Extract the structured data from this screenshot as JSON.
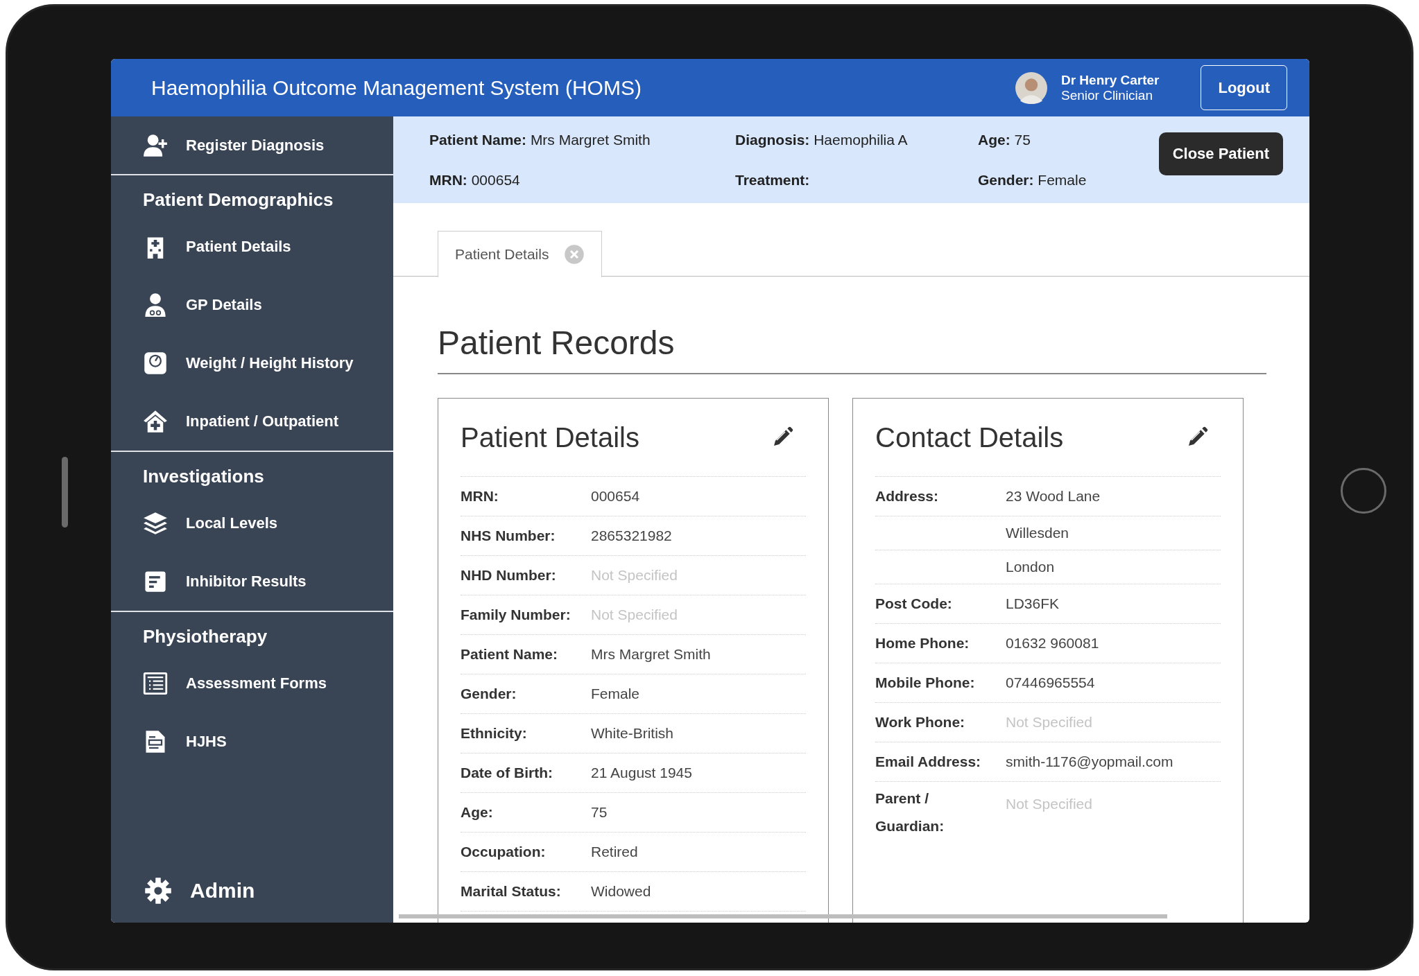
{
  "header": {
    "title": "Haemophilia Outcome Management System (HOMS)",
    "user_name": "Dr Henry Carter",
    "user_role": "Senior Clinician",
    "logout": "Logout"
  },
  "sidebar": {
    "items": [
      {
        "kind": "item",
        "label": "Register Diagnosis"
      },
      {
        "kind": "section",
        "label": "Patient Demographics"
      },
      {
        "kind": "item",
        "label": "Patient Details"
      },
      {
        "kind": "item",
        "label": "GP Details"
      },
      {
        "kind": "item",
        "label": "Weight / Height History"
      },
      {
        "kind": "item",
        "label": "Inpatient / Outpatient"
      },
      {
        "kind": "section",
        "label": "Investigations"
      },
      {
        "kind": "item",
        "label": "Local Levels"
      },
      {
        "kind": "item",
        "label": "Inhibitor Results"
      },
      {
        "kind": "section",
        "label": "Physiotherapy"
      },
      {
        "kind": "item",
        "label": "Assessment Forms"
      },
      {
        "kind": "item",
        "label": "HJHS"
      }
    ],
    "admin": "Admin"
  },
  "patient_bar": {
    "fields": [
      {
        "label": "Patient Name:",
        "value": "Mrs Margret Smith"
      },
      {
        "label": "Diagnosis:",
        "value": "Haemophilia A"
      },
      {
        "label": "Age:",
        "value": "75"
      },
      {
        "label": "MRN:",
        "value": "000654"
      },
      {
        "label": "Treatment:"
      },
      {
        "label": "Gender:",
        "value": "Female"
      }
    ],
    "close_button": "Close Patient"
  },
  "tabs": [
    {
      "label": "Patient Details",
      "selected": true
    }
  ],
  "page_title": "Patient Records",
  "cards": [
    {
      "title": "Patient Details",
      "rows": [
        {
          "label": "MRN:",
          "value": "000654",
          "muted": false
        },
        {
          "label": "NHS Number:",
          "value": "2865321982",
          "muted": false
        },
        {
          "label": "NHD Number:",
          "value": "Not Specified",
          "muted": true
        },
        {
          "label": "Family Number:",
          "value": "Not Specified",
          "muted": true
        },
        {
          "label": "Patient Name:",
          "value": "Mrs Margret Smith",
          "muted": false
        },
        {
          "label": "Gender:",
          "value": "Female",
          "muted": false
        },
        {
          "label": "Ethnicity:",
          "value": "White-British",
          "muted": false
        },
        {
          "label": "Date of Birth:",
          "value": "21 August 1945",
          "muted": false
        },
        {
          "label": "Age:",
          "value": "75",
          "muted": false
        },
        {
          "label": "Occupation:",
          "value": "Retired",
          "muted": false
        },
        {
          "label": "Marital Status:",
          "value": "Widowed",
          "muted": false
        }
      ]
    },
    {
      "title": "Contact Details",
      "rows": [
        {
          "label": "Address:",
          "value": "23 Wood Lane",
          "muted": false
        },
        {
          "value": "Willesden",
          "muted": false
        },
        {
          "value": "London",
          "muted": false
        },
        {
          "label": "Post Code:",
          "value": "LD36FK",
          "muted": false
        },
        {
          "label": "Home Phone:",
          "value": "01632 960081",
          "muted": false
        },
        {
          "label": "Mobile Phone:",
          "value": "07446965554",
          "muted": false
        },
        {
          "label": "Work Phone:",
          "value": "Not Specified",
          "muted": true
        },
        {
          "label": "Email Address:",
          "value": "smith-1176@yopmail.com",
          "muted": false
        },
        {
          "label": "Parent / Guardian:",
          "value": "Not Specified",
          "muted": true
        }
      ]
    }
  ]
}
